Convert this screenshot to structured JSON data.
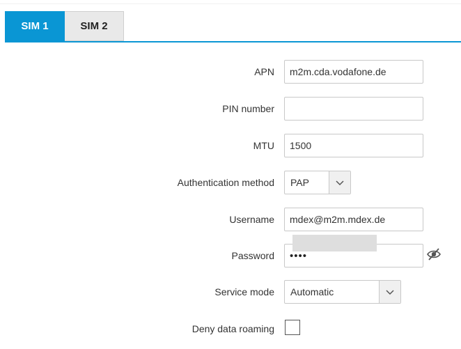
{
  "tabs": [
    {
      "label": "SIM 1",
      "active": true
    },
    {
      "label": "SIM 2",
      "active": false
    }
  ],
  "accent_color": "#0a96d4",
  "form": {
    "apn": {
      "label": "APN",
      "value": "m2m.cda.vodafone.de"
    },
    "pin": {
      "label": "PIN number",
      "value": ""
    },
    "mtu": {
      "label": "MTU",
      "value": "1500"
    },
    "auth": {
      "label": "Authentication method",
      "value": "PAP",
      "icon": "chevron-down-icon"
    },
    "username": {
      "label": "Username",
      "value": "mdex@m2m.mdex.de"
    },
    "password": {
      "label": "Password",
      "masked_value": "••••",
      "icon": "eye-slash-icon"
    },
    "service_mode": {
      "label": "Service mode",
      "value": "Automatic",
      "icon": "chevron-down-icon"
    },
    "deny_roaming": {
      "label": "Deny data roaming",
      "checked": false
    }
  }
}
